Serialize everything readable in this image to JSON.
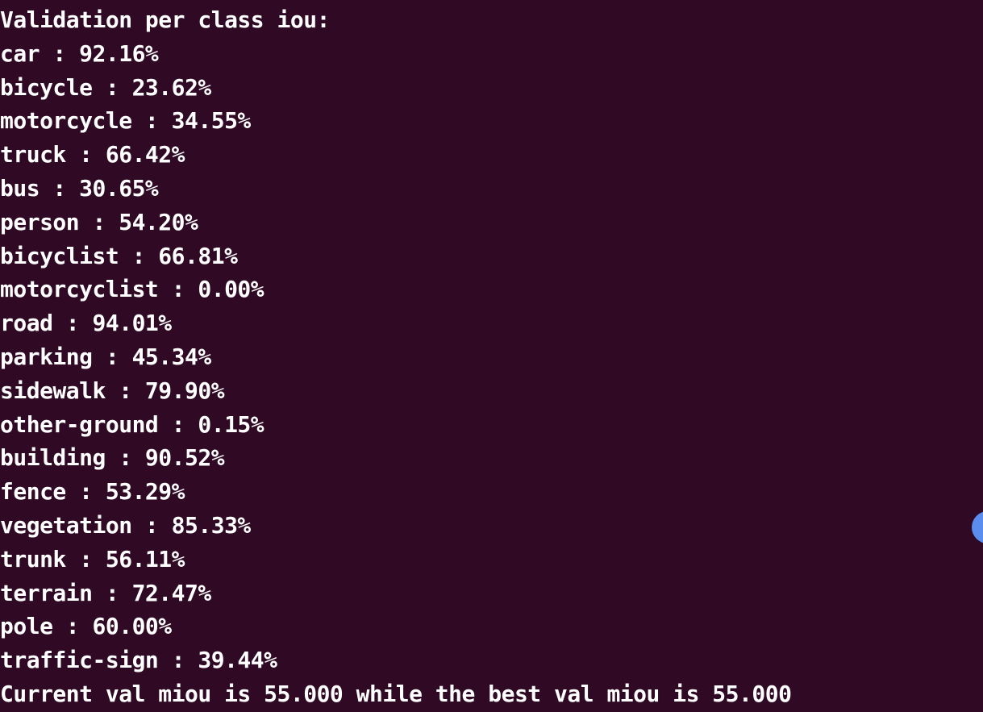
{
  "terminal": {
    "header": "Validation per class iou:",
    "lines": [
      "car : 92.16%",
      "bicycle : 23.62%",
      "motorcycle : 34.55%",
      "truck : 66.42%",
      "bus : 30.65%",
      "person : 54.20%",
      "bicyclist : 66.81%",
      "motorcyclist : 0.00%",
      "road : 94.01%",
      "parking : 45.34%",
      "sidewalk : 79.90%",
      "other-ground : 0.15%",
      "building : 90.52%",
      "fence : 53.29%",
      "vegetation : 85.33%",
      "trunk : 56.11%",
      "terrain : 72.47%",
      "pole : 60.00%",
      "traffic-sign : 39.44%"
    ],
    "summary": "Current val miou is 55.000 while the best val miou is 55.000"
  },
  "colors": {
    "background": "#300a24",
    "text": "#ffffff",
    "indicator": "#5b8def"
  }
}
